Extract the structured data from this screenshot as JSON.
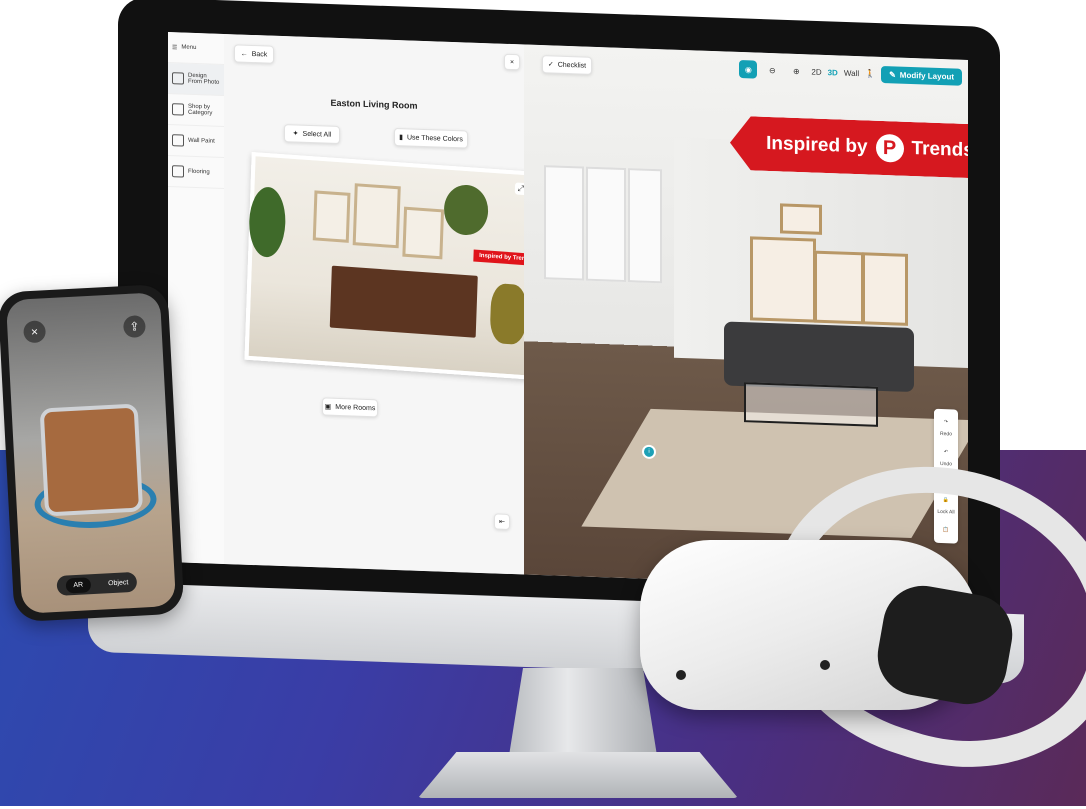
{
  "menu": {
    "title": "Menu",
    "items": [
      {
        "label": "Design From Photo"
      },
      {
        "label": "Shop by Category"
      },
      {
        "label": "Wall Paint"
      },
      {
        "label": "Flooring"
      }
    ]
  },
  "panel": {
    "back_label": "Back",
    "room_title": "Easton Living Room",
    "select_all_label": "Select All",
    "use_colors_label": "Use These Colors",
    "photo_tag": "Inspired by Trends",
    "more_rooms_label": "More Rooms"
  },
  "toolbar": {
    "checklist_label": "Checklist",
    "view_2d": "2D",
    "view_3d": "3D",
    "wall": "Wall",
    "modify_label": "Modify Layout"
  },
  "banner": {
    "left": "Inspired by",
    "right": "Trends"
  },
  "right_tools": {
    "redo": "Redo",
    "undo": "Undo",
    "lock": "Lock All"
  },
  "phone": {
    "ar_label": "AR",
    "object_label": "Object"
  },
  "colors": {
    "accent": "#12a0b5",
    "brand_red": "#d6181f"
  }
}
